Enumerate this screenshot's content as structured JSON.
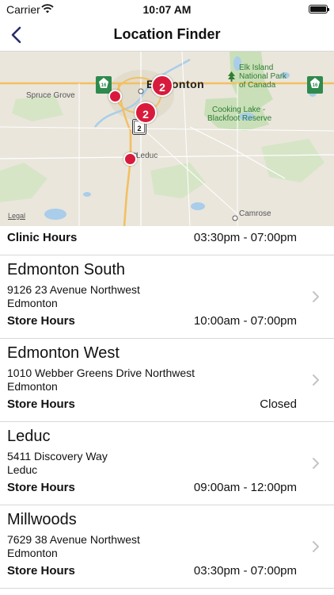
{
  "status_bar": {
    "carrier": "Carrier",
    "time": "10:07 AM"
  },
  "nav": {
    "title": "Location Finder",
    "back_icon": "chevron-left-icon"
  },
  "map": {
    "labels": {
      "edmonton": "Edmonton",
      "spruce_grove": "Spruce Grove",
      "leduc": "Leduc",
      "camrose": "Camrose",
      "elk_island": "Elk Island",
      "national_park": "National Park",
      "of_canada": "of Canada",
      "cooking_lake": "Cooking Lake -",
      "blackfoot": "Blackfoot Reserve"
    },
    "highway_shields": [
      "16",
      "16",
      "2"
    ],
    "clusters": [
      "2",
      "2"
    ],
    "legal": "Legal",
    "colors": {
      "pin": "#d81b3c",
      "park": "#c9dfb8",
      "water": "#a9cdea",
      "road": "#f2c062"
    }
  },
  "partial_row": {
    "label": "Clinic Hours",
    "hours": "03:30pm - 07:00pm"
  },
  "locations": [
    {
      "name": "Edmonton South",
      "street": "9126 23 Avenue Northwest",
      "city": "Edmonton",
      "hours_label": "Store Hours",
      "hours": "10:00am - 07:00pm"
    },
    {
      "name": "Edmonton West",
      "street": "1010 Webber Greens Drive Northwest",
      "city": "Edmonton",
      "hours_label": "Store Hours",
      "hours": "Closed"
    },
    {
      "name": "Leduc",
      "street": "5411 Discovery Way",
      "city": "Leduc",
      "hours_label": "Store Hours",
      "hours": "09:00am - 12:00pm"
    },
    {
      "name": "Millwoods",
      "street": "7629 38 Avenue Northwest",
      "city": "Edmonton",
      "hours_label": "Store Hours",
      "hours": "03:30pm - 07:00pm"
    }
  ]
}
